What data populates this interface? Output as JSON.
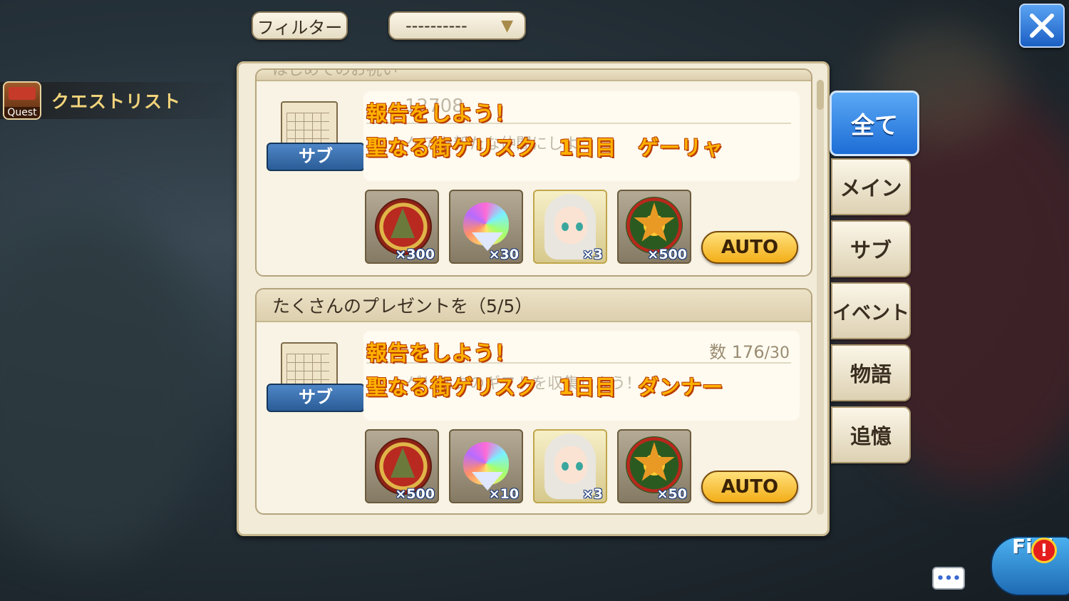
{
  "filter": {
    "label": "フィルター",
    "selected": "----------"
  },
  "header": {
    "title": "クエストリスト",
    "icon_label": "Quest"
  },
  "quests": [
    {
      "title": "はじめてのお祝い",
      "category": "サブ",
      "count_ghost": "12708",
      "ghost_desc": "ケアを新たな仲間にしよう！",
      "report_line": "報告をしよう！",
      "location_line": "聖なる街ゲリスク　1日目　ゲーリャ",
      "rewards": [
        {
          "icon": "tree-coin-icon",
          "qty": "×300"
        },
        {
          "icon": "rainbow-gem-icon",
          "qty": "×30"
        },
        {
          "icon": "girl-portrait-icon",
          "qty": "×3"
        },
        {
          "icon": "star-wreath-icon",
          "qty": "×500"
        }
      ],
      "auto_label": "AUTO"
    },
    {
      "title": "たくさんのプレゼントを（5/5）",
      "category": "サブ",
      "count_prefix": "数",
      "count_value": "176",
      "count_cap": "/30",
      "ghost_desc": "ゲリスクのギフトを収集しよう！",
      "report_line": "報告をしよう！",
      "location_line": "聖なる街ゲリスク　1日目　ダンナー",
      "rewards": [
        {
          "icon": "tree-coin-icon",
          "qty": "×500"
        },
        {
          "icon": "rainbow-gem-icon",
          "qty": "×10"
        },
        {
          "icon": "girl-portrait-icon",
          "qty": "×3"
        },
        {
          "icon": "star-wreath-icon",
          "qty": "×50"
        }
      ],
      "auto_label": "AUTO"
    }
  ],
  "tabs": [
    {
      "label": "全て",
      "active": true
    },
    {
      "label": "メイン"
    },
    {
      "label": "サブ"
    },
    {
      "label": "イベント"
    },
    {
      "label": "物語"
    },
    {
      "label": "追憶"
    }
  ],
  "field_button": {
    "label": "Fi  d",
    "alert": "!"
  },
  "chat_button": {
    "label": "•••"
  },
  "colors": {
    "accent_blue": "#1d6dd6",
    "highlight_orange": "#ffb100",
    "auto_gold": "#f3ae18"
  }
}
